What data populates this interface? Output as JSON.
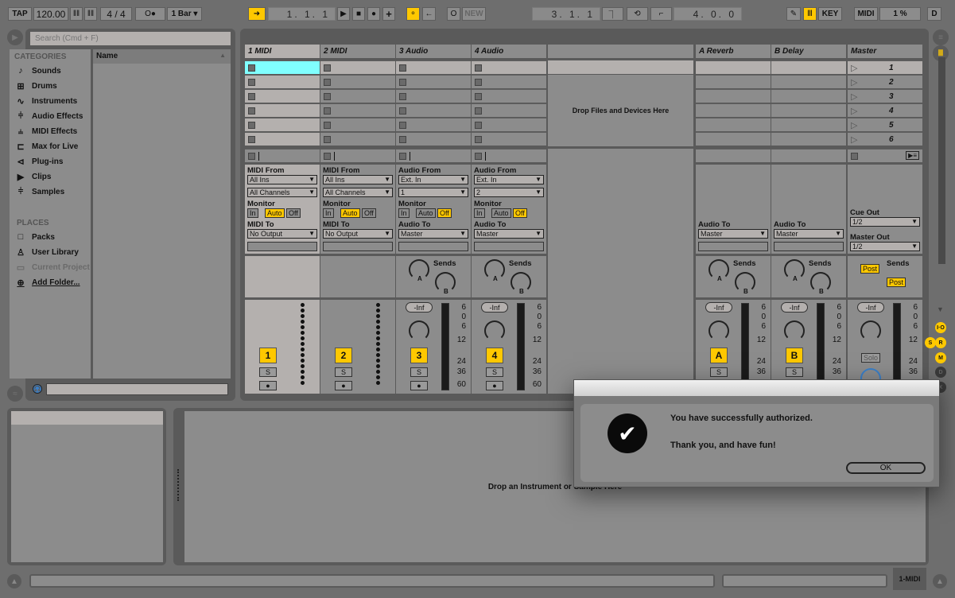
{
  "toolbar": {
    "tap": "TAP",
    "tempo": "120.00",
    "signature": "4 / 4",
    "metronome": "O●",
    "quantize": "1 Bar",
    "position": "1.  1.  1",
    "new_label": "NEW",
    "loop_start": "3.  1.  1",
    "loop_length": "4.  0.  0",
    "key_label": "KEY",
    "midi_label": "MIDI",
    "cpu": "1 %",
    "d_label": "D"
  },
  "browser": {
    "search_placeholder": "Search (Cmd + F)",
    "categories_heading": "CATEGORIES",
    "name_column": "Name",
    "categories": [
      {
        "label": "Sounds",
        "icon": "♪"
      },
      {
        "label": "Drums",
        "icon": "⊞"
      },
      {
        "label": "Instruments",
        "icon": "∿"
      },
      {
        "label": "Audio Effects",
        "icon": "⫩"
      },
      {
        "label": "MIDI Effects",
        "icon": "⫨"
      },
      {
        "label": "Max for Live",
        "icon": "⊏"
      },
      {
        "label": "Plug-ins",
        "icon": "⊲"
      },
      {
        "label": "Clips",
        "icon": "▶"
      },
      {
        "label": "Samples",
        "icon": "⫩"
      }
    ],
    "places_heading": "PLACES",
    "places": [
      {
        "label": "Packs",
        "icon": "□"
      },
      {
        "label": "User Library",
        "icon": "♙"
      },
      {
        "label": "Current Project",
        "icon": "▭"
      },
      {
        "label": "Add Folder...",
        "icon": "⊕"
      }
    ]
  },
  "session": {
    "drop_text": "Drop Files and Devices Here",
    "tracks": [
      {
        "name": "1 MIDI",
        "from_label": "MIDI From",
        "from": "All Ins",
        "channel": "All Channels",
        "monitor": "Auto",
        "to_label": "MIDI To",
        "to": "No Output",
        "number": "1"
      },
      {
        "name": "2 MIDI",
        "from_label": "MIDI From",
        "from": "All Ins",
        "channel": "All Channels",
        "monitor": "Auto",
        "to_label": "MIDI To",
        "to": "No Output",
        "number": "2"
      },
      {
        "name": "3 Audio",
        "from_label": "Audio From",
        "from": "Ext. In",
        "channel": "1",
        "monitor": "Off",
        "to_label": "Audio To",
        "to": "Master",
        "number": "3"
      },
      {
        "name": "4 Audio",
        "from_label": "Audio From",
        "from": "Ext. In",
        "channel": "2",
        "monitor": "Off",
        "to_label": "Audio To",
        "to": "Master",
        "number": "4"
      }
    ],
    "returns": [
      {
        "name": "A Reverb",
        "to_label": "Audio To",
        "to": "Master",
        "letter": "A"
      },
      {
        "name": "B Delay",
        "to_label": "Audio To",
        "to": "Master",
        "letter": "B"
      }
    ],
    "master": {
      "name": "Master",
      "scenes": [
        "1",
        "2",
        "3",
        "4",
        "5",
        "6"
      ],
      "cue_out_label": "Cue Out",
      "cue_out": "1/2",
      "master_out_label": "Master Out",
      "master_out": "1/2",
      "post": "Post",
      "solo": "Solo"
    },
    "monitor_label": "Monitor",
    "monitor_options": [
      "In",
      "Auto",
      "Off"
    ],
    "sends_label": "Sends",
    "volume": "-Inf",
    "solo_short": "S",
    "meter_scale": [
      "6",
      "0",
      "6",
      "12",
      "24",
      "36",
      "60"
    ]
  },
  "detail": {
    "drop_text": "Drop an Instrument or Sample Here"
  },
  "status": {
    "track_name": "1-MIDI"
  },
  "side_buttons": [
    "I·O",
    "S",
    "R",
    "M",
    "D",
    "X"
  ],
  "dialog": {
    "message": "You have successfully authorized.",
    "sub": "Thank you, and have fun!",
    "ok": "OK"
  },
  "colors": {
    "accent": "#ffc800",
    "selected_clip": "#80ffff"
  }
}
